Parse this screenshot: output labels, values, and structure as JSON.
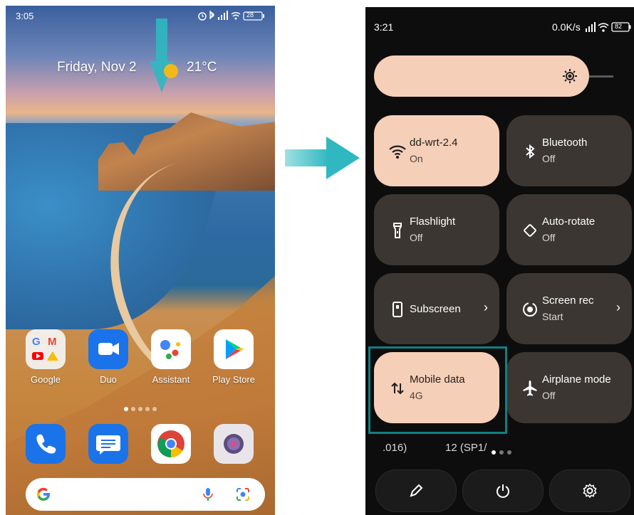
{
  "left_phone": {
    "status_time": "3:05",
    "status_icons": [
      "alarm-icon",
      "bluetooth-icon",
      "signal-icon",
      "wifi-icon"
    ],
    "battery": "28",
    "date": "Friday, Nov 2",
    "temperature": "21°C",
    "apps": [
      {
        "label": "Google",
        "icon": "google-folder-icon"
      },
      {
        "label": "Duo",
        "icon": "duo-icon",
        "color": "#1a73e8"
      },
      {
        "label": "Assistant",
        "icon": "assistant-icon"
      },
      {
        "label": "Play Store",
        "icon": "play-store-icon"
      }
    ],
    "dock": [
      {
        "icon": "phone-icon",
        "color": "#1a73e8"
      },
      {
        "icon": "messages-icon",
        "color": "#1a73e8"
      },
      {
        "icon": "chrome-icon"
      },
      {
        "icon": "camera-icon"
      }
    ],
    "search": {
      "google_icon": "google-g-icon",
      "mic_icon": "mic-icon",
      "lens_icon": "lens-icon"
    }
  },
  "right_phone": {
    "status_time": "3:21",
    "net_speed": "0.0K/s",
    "battery": "82",
    "tiles": [
      {
        "title": "dd-wrt-2.4",
        "subtitle": "On",
        "icon": "wifi-icon",
        "active": true
      },
      {
        "title": "Bluetooth",
        "subtitle": "Off",
        "icon": "bluetooth-icon",
        "active": false
      },
      {
        "title": "Flashlight",
        "subtitle": "Off",
        "icon": "flashlight-icon",
        "active": false
      },
      {
        "title": "Auto-rotate",
        "subtitle": "Off",
        "icon": "auto-rotate-icon",
        "active": false
      },
      {
        "title": "Subscreen",
        "subtitle": "",
        "icon": "subscreen-icon",
        "active": false
      },
      {
        "title": "Screen rec",
        "subtitle": "Start",
        "icon": "screen-record-icon",
        "active": false
      },
      {
        "title": "Mobile data",
        "subtitle": "4G",
        "icon": "mobile-data-icon",
        "active": true
      },
      {
        "title": "Airplane mode",
        "subtitle": "Off",
        "icon": "airplane-icon",
        "active": false
      }
    ],
    "carrier_left": ".016)",
    "carrier_right": "12 (SP1/",
    "bottom_buttons": [
      "edit-icon",
      "power-icon",
      "settings-icon"
    ]
  },
  "colors": {
    "tile_on": "#f6cfb8",
    "tile_off": "#3b3631",
    "highlight": "#0f7f84",
    "arrow": "#2fb8c0"
  }
}
